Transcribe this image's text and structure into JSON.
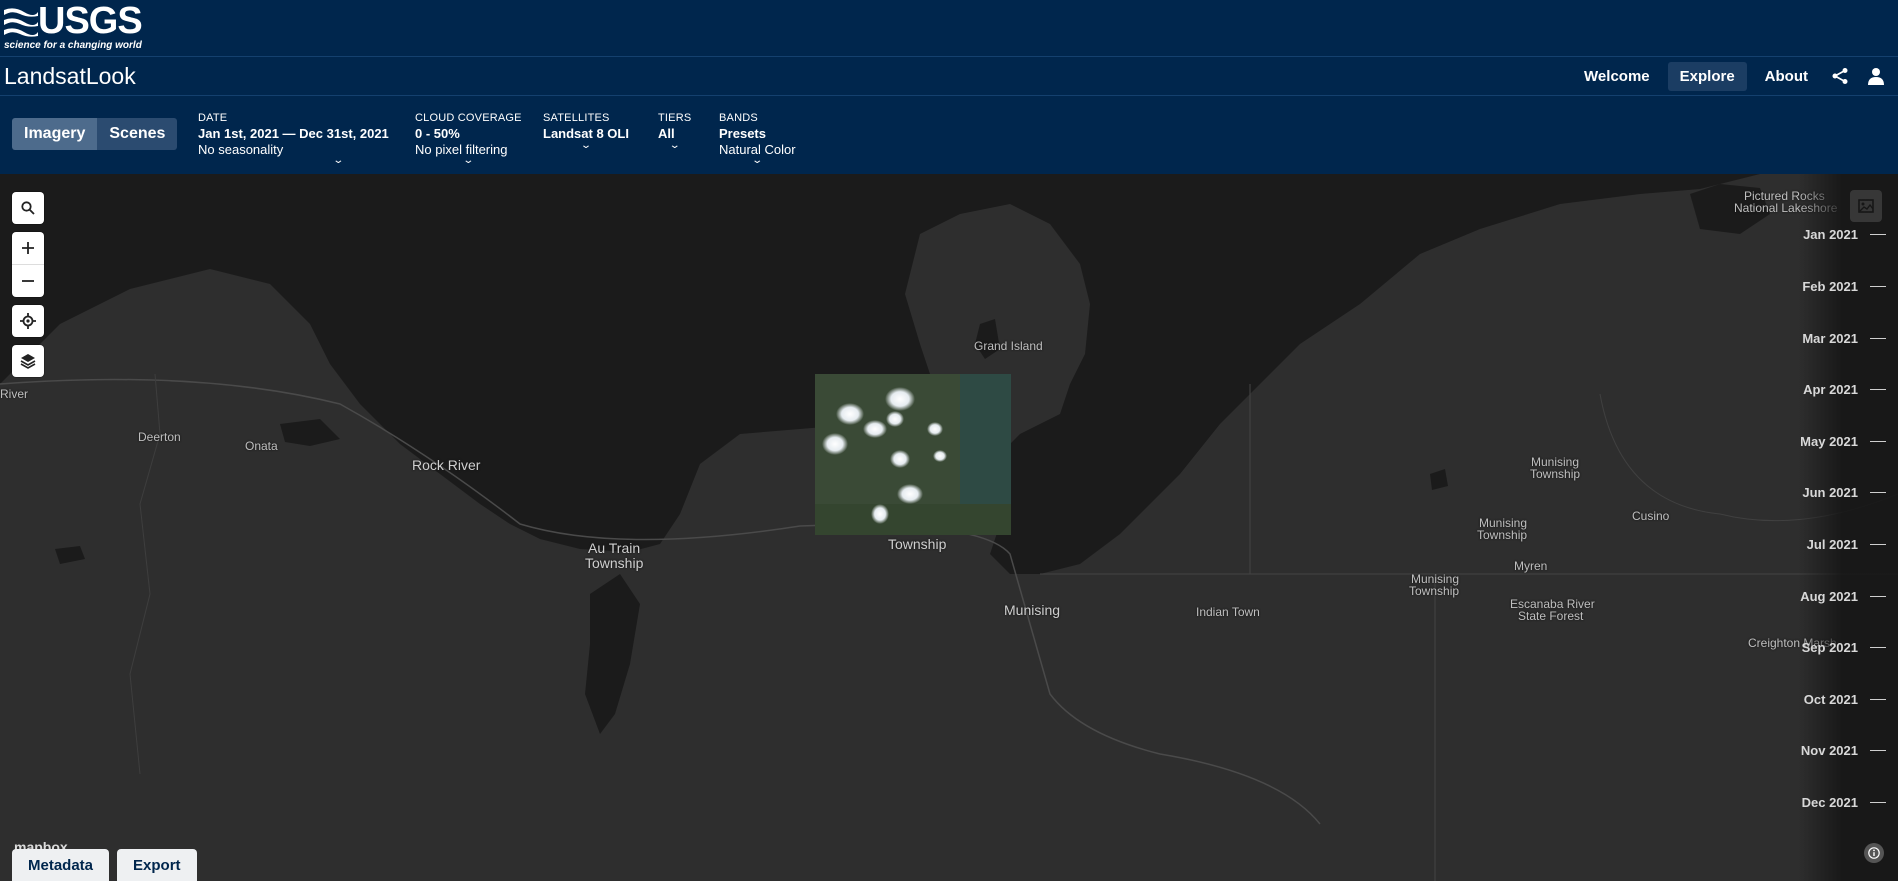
{
  "header": {
    "logo_text": "USGS",
    "logo_tagline": "science for a changing world",
    "app_title": "LandsatLook",
    "nav": [
      {
        "label": "Welcome",
        "active": false
      },
      {
        "label": "Explore",
        "active": true
      },
      {
        "label": "About",
        "active": false
      }
    ],
    "share_icon": "share-icon",
    "user_icon": "user-icon"
  },
  "filters": {
    "view_toggle": [
      {
        "label": "Imagery",
        "selected": true
      },
      {
        "label": "Scenes",
        "selected": false
      }
    ],
    "date": {
      "label": "DATE",
      "value": "Jan 1st, 2021 — Dec 31st, 2021",
      "sub": "No seasonality"
    },
    "cloud": {
      "label": "CLOUD COVERAGE",
      "value": "0 - 50%",
      "sub": "No pixel filtering"
    },
    "satellites": {
      "label": "SATELLITES",
      "value": "Landsat 8 OLI"
    },
    "tiers": {
      "label": "TIERS",
      "value": "All"
    },
    "bands": {
      "label": "BANDS",
      "value": "Presets",
      "sub": "Natural Color"
    },
    "chevron": "⌄"
  },
  "map": {
    "places": {
      "grand_island": "Grand Island",
      "rock_river": "Rock River",
      "au_train": "Au Train",
      "au_train_township": "Township",
      "township": "Township",
      "munising": "Munising",
      "deerton": "Deerton",
      "onata": "Onata",
      "river": "River",
      "indian_town": "Indian Town",
      "munising_twp_1a": "Munising",
      "munising_twp_1b": "Township",
      "munising_twp_2a": "Munising",
      "munising_twp_2b": "Township",
      "munising_twp_3a": "Munising",
      "munising_twp_3b": "Township",
      "myren": "Myren",
      "cusino": "Cusino",
      "escanaba_a": "Escanaba River",
      "escanaba_b": "State Forest",
      "pictured_a": "Pictured Rocks",
      "pictured_b": "National Lakeshore",
      "creighton": "Creighton Marsh"
    },
    "controls": [
      "search-icon",
      "zoom-in-icon",
      "zoom-out-icon",
      "locate-icon",
      "layers-icon",
      "gallery-icon"
    ],
    "attribution": "mapbox"
  },
  "timeline": [
    "Jan 2021",
    "Feb 2021",
    "Mar 2021",
    "Apr 2021",
    "May 2021",
    "Jun 2021",
    "Jul 2021",
    "Aug 2021",
    "Sep 2021",
    "Oct 2021",
    "Nov 2021",
    "Dec 2021"
  ],
  "bottom_tabs": [
    "Metadata",
    "Export"
  ],
  "colors": {
    "header_bg": "#00264d",
    "map_land": "#2e2e2e",
    "map_water": "#1b1b1b",
    "active_nav": "#1b3d63"
  }
}
